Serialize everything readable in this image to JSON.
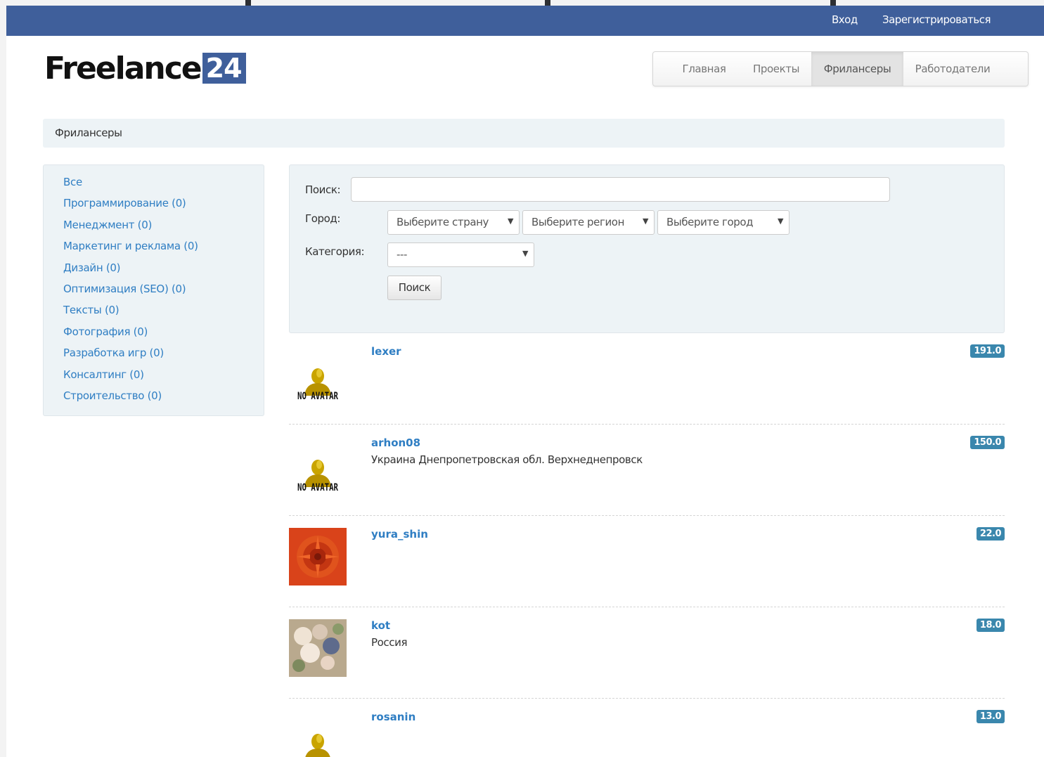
{
  "navbar": {
    "login": "Вход",
    "register": "Зарегистрироваться"
  },
  "logo": {
    "word": "Freelance",
    "number": "24"
  },
  "mainnav": {
    "tabs": [
      {
        "label": "Главная",
        "active": false
      },
      {
        "label": "Проекты",
        "active": false
      },
      {
        "label": "Фрилансеры",
        "active": true
      },
      {
        "label": "Работодатели",
        "active": false
      }
    ]
  },
  "breadcrumb": {
    "current": "Фрилансеры"
  },
  "sidebar": {
    "items": [
      {
        "label": "Все"
      },
      {
        "label": "Программирование (0)"
      },
      {
        "label": "Менеджмент (0)"
      },
      {
        "label": "Маркетинг и реклама (0)"
      },
      {
        "label": "Дизайн (0)"
      },
      {
        "label": "Оптимизация (SEO) (0)"
      },
      {
        "label": "Тексты (0)"
      },
      {
        "label": "Фотография (0)"
      },
      {
        "label": "Разработка игр (0)"
      },
      {
        "label": "Консалтинг (0)"
      },
      {
        "label": "Строительство (0)"
      }
    ]
  },
  "search": {
    "search_label": "Поиск:",
    "search_value": "",
    "city_label": "Город:",
    "country_select": "Выберите страну",
    "region_select": "Выберите регион",
    "city_select": "Выберите город",
    "category_label": "Категория:",
    "category_select": "---",
    "button": "Поиск"
  },
  "freelancers": [
    {
      "name": "lexer",
      "location": "",
      "rating": "191.0",
      "avatar": "no-avatar"
    },
    {
      "name": "arhon08",
      "location": "Украина Днепропетровская обл. Верхнеднепровск",
      "rating": "150.0",
      "avatar": "no-avatar"
    },
    {
      "name": "yura_shin",
      "location": "",
      "rating": "22.0",
      "avatar": "flower-photo"
    },
    {
      "name": "kot",
      "location": "Россия",
      "rating": "18.0",
      "avatar": "bouquet-photo"
    },
    {
      "name": "rosanin",
      "location": "",
      "rating": "13.0",
      "avatar": "no-avatar"
    }
  ],
  "avatar_text": "NO AVATAR",
  "colors": {
    "navbar": "#3f5f9b",
    "link": "#2f7ec3",
    "badge": "#3a87ad",
    "panel": "#edf3f6"
  }
}
